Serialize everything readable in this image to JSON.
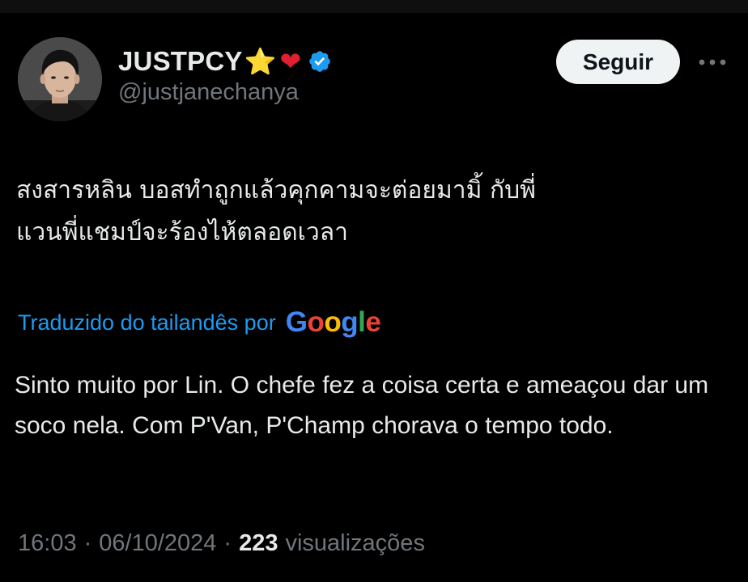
{
  "header": {
    "display_name": "JUSTPCY",
    "emojis": [
      "⭐",
      "❤"
    ],
    "handle": "@justjanechanya",
    "verified": true,
    "follow_label": "Seguir",
    "more_icon": "more-horizontal-icon"
  },
  "tweet": {
    "original_text": "สงสารหลิน บอสทำถูกแล้วคุกคามจะต่อยมามิ้ กับพี่\nแวนพี่แชมป์จะร้องไห้ตลอดเวลา",
    "translated_label": "Traduzido do tailandês por",
    "translator_brand": [
      "G",
      "o",
      "o",
      "g",
      "l",
      "e"
    ],
    "translated_text": "Sinto muito por Lin. O chefe fez a coisa certa e ameaçou dar um soco nela. Com P'Van, P'Champ chorava o tempo todo."
  },
  "meta": {
    "time": "16:03",
    "date": "06/10/2024",
    "views_count": "223",
    "views_label": "visualizações",
    "separator": "·"
  },
  "colors": {
    "background": "#000000",
    "text": "#e7e9ea",
    "muted": "#71767b",
    "link": "#1d9bf0",
    "verified": "#1d9bf0",
    "follow_bg": "#eff3f4"
  }
}
